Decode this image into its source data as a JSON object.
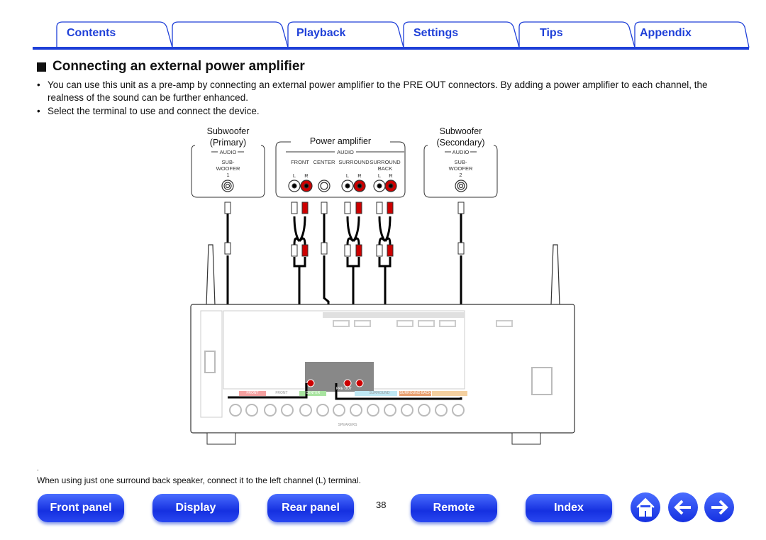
{
  "tabs": [
    {
      "label": "Contents"
    },
    {
      "label": ""
    },
    {
      "label": "Playback"
    },
    {
      "label": "Settings"
    },
    {
      "label": "Tips"
    },
    {
      "label": "Appendix"
    }
  ],
  "accent_color": "#1e3fd8",
  "section": {
    "title": "Connecting an external power amplifier"
  },
  "bullets": [
    "You can use this unit as a pre-amp by connecting an external power amplifier to the PRE OUT connectors. By adding a power amplifier to each channel, the realness of the sound can be further enhanced.",
    "Select the terminal to use and connect the device."
  ],
  "diagram": {
    "sub_primary": {
      "title1": "Subwoofer",
      "title2": "(Primary)",
      "audio": "AUDIO",
      "jack1": "SUB-",
      "jack2": "WOOFER",
      "num": "1"
    },
    "power_amp": {
      "title": "Power amplifier",
      "audio": "AUDIO",
      "front": "FRONT",
      "center": "CENTER",
      "surround": "SURROUND",
      "surround_back1": "SURROUND",
      "surround_back2": "BACK",
      "l": "L",
      "r": "R"
    },
    "sub_secondary": {
      "title1": "Subwoofer",
      "title2": "(Secondary)",
      "audio": "AUDIO",
      "jack1": "SUB-",
      "jack2": "WOOFER",
      "num": "2"
    },
    "receiver": {
      "pre_out": "PRE OUT",
      "speakers": "SPEAKERS",
      "front": "FRONT",
      "center": "CENTER",
      "surround": "SURROUND",
      "surround_back": "SURROUND BACK"
    }
  },
  "note_mark": ".",
  "note": "When using just one surround back speaker, connect it to the left channel (L) terminal.",
  "footer": {
    "front_panel": "Front panel",
    "display": "Display",
    "rear_panel": "Rear panel",
    "page": "38",
    "remote": "Remote",
    "index": "Index"
  },
  "icons": {
    "home": "home-icon",
    "back": "arrow-left-icon",
    "forward": "arrow-right-icon"
  }
}
